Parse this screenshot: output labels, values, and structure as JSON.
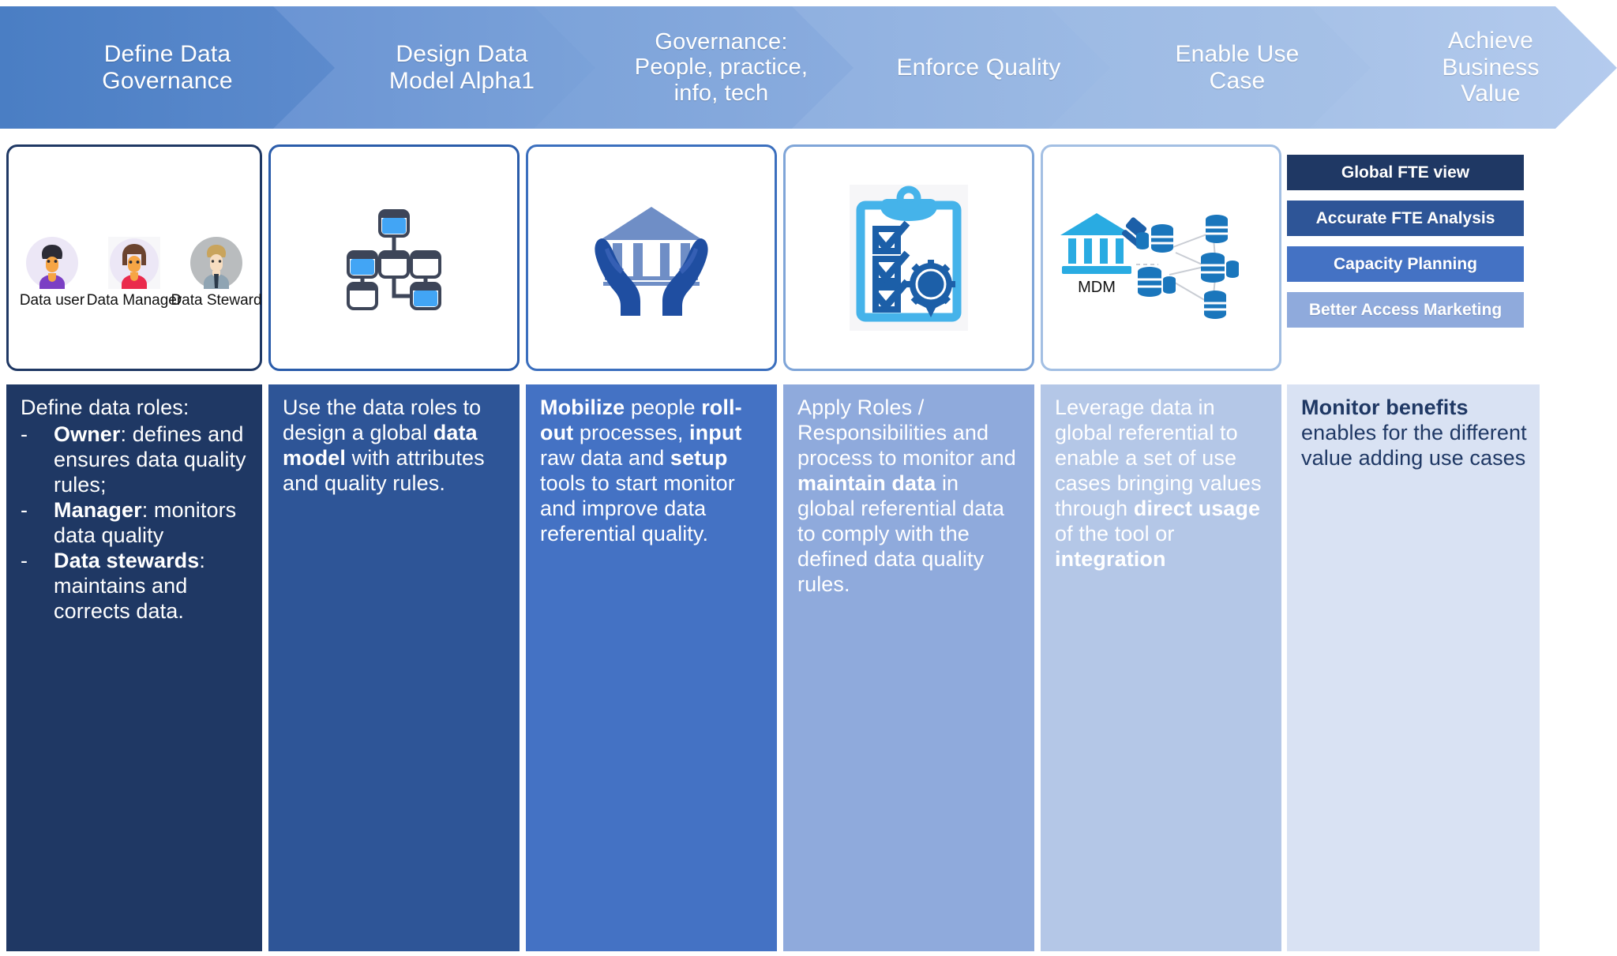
{
  "header": {
    "steps": [
      {
        "label": "Define Data Governance",
        "color_start": "#4a7ec4",
        "color_end": "#5d8bcd"
      },
      {
        "label": "Design Data\nModel Alpha1",
        "color_start": "#6d97d4",
        "color_end": "#7ba2d9"
      },
      {
        "label": "Governance:\nPeople, practice,\ninfo, tech",
        "color_start": "#7ba2d9",
        "color_end": "#88abdd"
      },
      {
        "label": "Enforce Quality",
        "color_start": "#8fb0e0",
        "color_end": "#9cbae4"
      },
      {
        "label": "Enable Use Case",
        "color_start": "#9cbae4",
        "color_end": "#a6c1e7"
      },
      {
        "label": "Achieve Business\nValue",
        "color_start": "#a6c1e7",
        "color_end": "#b3cbec"
      }
    ]
  },
  "cards": [
    {
      "name": "data-roles-card",
      "icon": "people-avatars",
      "border_color": "#1f3864",
      "persons": [
        {
          "label": "Data user",
          "icon": "avatar-data-user"
        },
        {
          "label": "Data Manager",
          "icon": "avatar-data-manager"
        },
        {
          "label": "Data Steward",
          "icon": "avatar-data-steward"
        }
      ]
    },
    {
      "name": "data-model-card",
      "icon": "network-nodes-diagram",
      "border_color": "#2a5caa"
    },
    {
      "name": "governance-card",
      "icon": "hands-holding-institution",
      "border_color": "#3b6fbe"
    },
    {
      "name": "quality-card",
      "icon": "clipboard-checklist-award",
      "border_color": "#7fa5d8"
    },
    {
      "name": "use-case-card",
      "icon": "mdm-database-network",
      "border_color": "#a3bfe3",
      "mdm_label": "MDM"
    }
  ],
  "benefit_tiles": [
    {
      "label": "Global FTE view",
      "color": "#1f3864"
    },
    {
      "label": "Accurate FTE Analysis",
      "color": "#2e5597"
    },
    {
      "label": "Capacity Planning",
      "color": "#4472c4"
    },
    {
      "label": "Better Access Marketing",
      "color": "#8faadc"
    }
  ],
  "columns": [
    {
      "name": "define-governance-column",
      "bg": "#1f3864",
      "text_color": "#ffffff",
      "intro": "Define data roles:",
      "bullets": [
        {
          "dash": "-",
          "bold": "Owner",
          "rest": ": defines and ensures data quality rules;"
        },
        {
          "dash": "-",
          "bold": "Manager",
          "rest": ": monitors data quality"
        },
        {
          "dash": "-",
          "bold": "Data stewards",
          "rest": ": maintains and corrects data."
        }
      ]
    },
    {
      "name": "design-data-model-column",
      "bg": "#2e5597",
      "text_color": "#ffffff",
      "segments": [
        {
          "text": "Use the data roles to design a global ",
          "bold": false
        },
        {
          "text": "data model",
          "bold": true
        },
        {
          "text": " with attributes and quality rules.",
          "bold": false
        }
      ]
    },
    {
      "name": "governance-people-column",
      "bg": "#4472c4",
      "text_color": "#ffffff",
      "segments": [
        {
          "text": "Mobilize",
          "bold": true
        },
        {
          "text": " people ",
          "bold": false
        },
        {
          "text": "roll-out",
          "bold": true
        },
        {
          "text": " processes, ",
          "bold": false
        },
        {
          "text": "input",
          "bold": true
        },
        {
          "text": " raw data and ",
          "bold": false
        },
        {
          "text": "setup",
          "bold": true
        },
        {
          "text": " tools to start monitor and improve data referential quality.",
          "bold": false
        }
      ]
    },
    {
      "name": "enforce-quality-column",
      "bg": "#8faadc",
      "text_color": "#ffffff",
      "segments": [
        {
          "text": "Apply Roles / Responsibilities and process to monitor and ",
          "bold": false
        },
        {
          "text": "maintain data",
          "bold": true
        },
        {
          "text": " in global referential data to comply with the defined data quality rules.",
          "bold": false
        }
      ]
    },
    {
      "name": "enable-use-case-column",
      "bg": "#b4c7e7",
      "text_color": "#ffffff",
      "segments": [
        {
          "text": "Leverage data in global referential to enable a set of use cases bringing values through ",
          "bold": false
        },
        {
          "text": "direct usage",
          "bold": true
        },
        {
          "text": " of the tool or ",
          "bold": false
        },
        {
          "text": "integration",
          "bold": true
        }
      ]
    },
    {
      "name": "achieve-business-value-column",
      "bg": "#d9e2f3",
      "text_color": "#1f3864",
      "segments": [
        {
          "text": "Monitor benefits",
          "bold": true
        },
        {
          "text": " enables for the different value adding use cases",
          "bold": false
        }
      ]
    }
  ]
}
